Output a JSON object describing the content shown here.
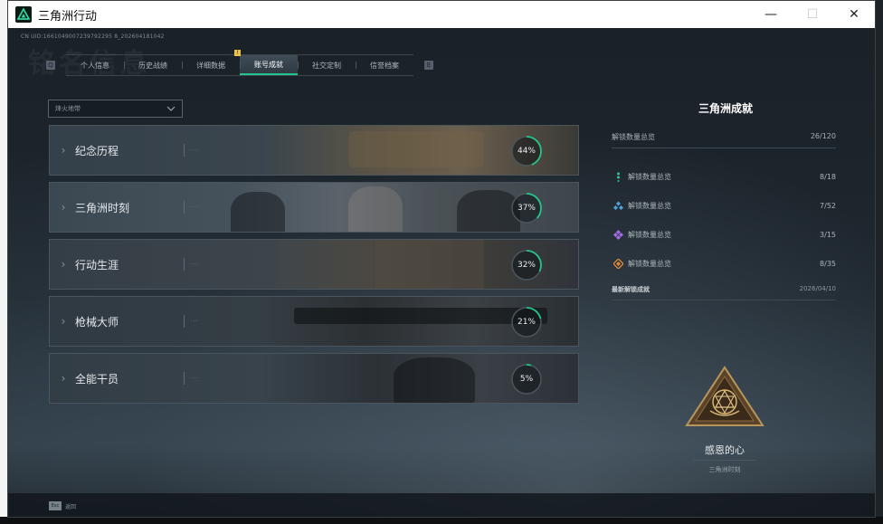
{
  "window": {
    "title": "三角洲行动",
    "controls": {
      "minimize": "—",
      "maximize": "☐",
      "close": "✕"
    }
  },
  "header": {
    "uid": "CN UID:1661049007239792295 8_202604181042",
    "ghost_title": "铭名信息"
  },
  "tabs": [
    {
      "label": "个人信息",
      "active": false
    },
    {
      "label": "历史战绩",
      "active": false
    },
    {
      "label": "详细数据",
      "active": false
    },
    {
      "label": "账号成就",
      "active": true
    },
    {
      "label": "社交定制",
      "active": false
    },
    {
      "label": "信誉档案",
      "active": false
    }
  ],
  "tab_nav": {
    "prev": "Q",
    "next": "E",
    "badge": "!"
  },
  "filter": {
    "value": "烽火地带"
  },
  "categories": [
    {
      "title": "纪念历程",
      "percent_label": "44%",
      "percent": 44
    },
    {
      "title": "三角洲时刻",
      "percent_label": "37%",
      "percent": 37
    },
    {
      "title": "行动生涯",
      "percent_label": "32%",
      "percent": 32
    },
    {
      "title": "枪械大师",
      "percent_label": "21%",
      "percent": 21
    },
    {
      "title": "全能干员",
      "percent_label": "5%",
      "percent": 5
    }
  ],
  "panel": {
    "title": "三角洲成就",
    "summary_label": "解锁数量总览",
    "summary_count": "26/120",
    "stats": [
      {
        "label": "解锁数量总览",
        "count": "8/18",
        "color": "#2cc79a",
        "icon": "green-dots-icon"
      },
      {
        "label": "解锁数量总览",
        "count": "7/52",
        "color": "#4fa3e0",
        "icon": "blue-diamonds-icon"
      },
      {
        "label": "解锁数量总览",
        "count": "3/15",
        "color": "#a46ae6",
        "icon": "purple-diamonds-icon"
      },
      {
        "label": "解锁数量总览",
        "count": "8/35",
        "color": "#e2893a",
        "icon": "orange-diamond-icon"
      }
    ],
    "latest_label": "最新解锁成就",
    "latest_date": "2026/04/10"
  },
  "latest_achievement": {
    "name": "感恩的心",
    "category": "三角洲时刻"
  },
  "footer": {
    "key": "Esc",
    "label": "返回"
  },
  "colors": {
    "accent": "#22c58b",
    "ring_track": "#4a555d"
  }
}
